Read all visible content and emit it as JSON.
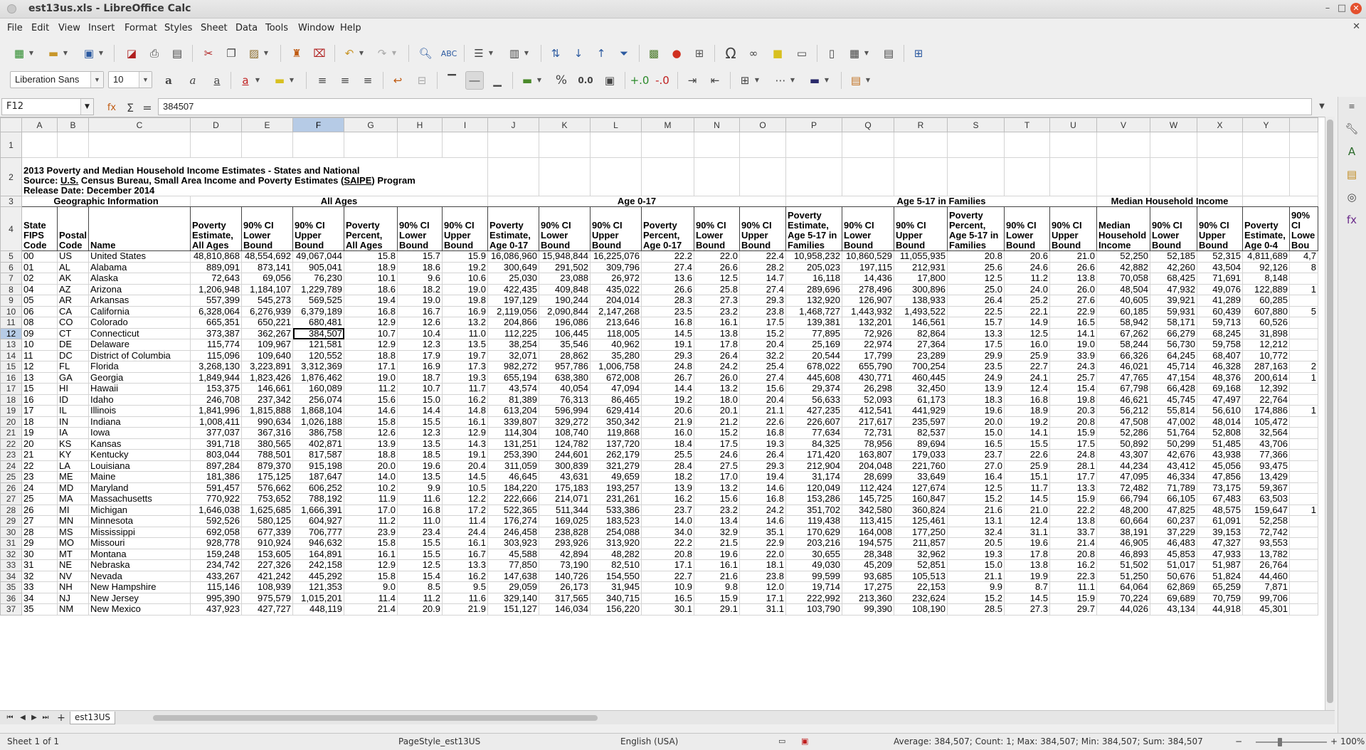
{
  "window": {
    "title": "est13us.xls - LibreOffice Calc"
  },
  "menu": [
    "File",
    "Edit",
    "View",
    "Insert",
    "Format",
    "Styles",
    "Sheet",
    "Data",
    "Tools",
    "Window",
    "Help"
  ],
  "font": {
    "name": "Liberation Sans",
    "size": "10"
  },
  "formula": {
    "cell_ref": "F12",
    "content": "384507"
  },
  "columns": [
    "A",
    "B",
    "C",
    "D",
    "E",
    "F",
    "G",
    "H",
    "I",
    "J",
    "K",
    "L",
    "M",
    "N",
    "O",
    "P",
    "Q",
    "R",
    "S",
    "T",
    "U",
    "V",
    "W",
    "X",
    "Y"
  ],
  "selected_column": "F",
  "selected_row": "12",
  "title_block": {
    "line1": "2013 Poverty and Median Household Income Estimates - States and National",
    "line2_prefix": "Source:  ",
    "line2_us": "U.S.",
    "line2_mid": " Census Bureau, Small Area Income and Poverty Estimates (",
    "line2_saipe": "SAIPE",
    "line2_suffix": ") Program",
    "line3": "Release Date:  December 2014"
  },
  "groups": {
    "geo": "Geographic Information",
    "all": "All Ages",
    "age017": "Age 0-17",
    "age517": "Age 5-17 in Families",
    "median": "Median Household Income"
  },
  "headers": [
    "State FIPS Code",
    "Postal Code",
    "Name",
    "Poverty Estimate, All Ages",
    "90% CI Lower Bound",
    "90% CI Upper Bound",
    "Poverty Percent, All Ages",
    "90% CI Lower Bound",
    "90% CI Upper Bound",
    "Poverty Estimate, Age 0-17",
    "90% CI Lower Bound",
    "90% CI Upper Bound",
    "Poverty Percent, Age 0-17",
    "90% CI Lower Bound",
    "90% CI Upper Bound",
    "Poverty Estimate, Age 5-17 in Families",
    "90% CI Lower Bound",
    "90% CI Upper Bound",
    "Poverty Percent, Age 5-17 in Families",
    "90% CI Lower Bound",
    "90% CI Upper Bound",
    "Median Household Income",
    "90% CI Lower Bound",
    "90% CI Upper Bound",
    "Poverty Estimate, Age 0-4",
    "90% CI Lowe Bou"
  ],
  "rows": [
    [
      "5",
      "00",
      "US",
      "United States",
      "48,810,868",
      "48,554,692",
      "49,067,044",
      "15.8",
      "15.7",
      "15.9",
      "16,086,960",
      "15,948,844",
      "16,225,076",
      "22.2",
      "22.0",
      "22.4",
      "10,958,232",
      "10,860,529",
      "11,055,935",
      "20.8",
      "20.6",
      "21.0",
      "52,250",
      "52,185",
      "52,315",
      "4,811,689",
      "4,7"
    ],
    [
      "6",
      "01",
      "AL",
      "Alabama",
      "889,091",
      "873,141",
      "905,041",
      "18.9",
      "18.6",
      "19.2",
      "300,649",
      "291,502",
      "309,796",
      "27.4",
      "26.6",
      "28.2",
      "205,023",
      "197,115",
      "212,931",
      "25.6",
      "24.6",
      "26.6",
      "42,882",
      "42,260",
      "43,504",
      "92,126",
      "8"
    ],
    [
      "7",
      "02",
      "AK",
      "Alaska",
      "72,643",
      "69,056",
      "76,230",
      "10.1",
      "9.6",
      "10.6",
      "25,030",
      "23,088",
      "26,972",
      "13.6",
      "12.5",
      "14.7",
      "16,118",
      "14,436",
      "17,800",
      "12.5",
      "11.2",
      "13.8",
      "70,058",
      "68,425",
      "71,691",
      "8,148",
      ""
    ],
    [
      "8",
      "04",
      "AZ",
      "Arizona",
      "1,206,948",
      "1,184,107",
      "1,229,789",
      "18.6",
      "18.2",
      "19.0",
      "422,435",
      "409,848",
      "435,022",
      "26.6",
      "25.8",
      "27.4",
      "289,696",
      "278,496",
      "300,896",
      "25.0",
      "24.0",
      "26.0",
      "48,504",
      "47,932",
      "49,076",
      "122,889",
      "1"
    ],
    [
      "9",
      "05",
      "AR",
      "Arkansas",
      "557,399",
      "545,273",
      "569,525",
      "19.4",
      "19.0",
      "19.8",
      "197,129",
      "190,244",
      "204,014",
      "28.3",
      "27.3",
      "29.3",
      "132,920",
      "126,907",
      "138,933",
      "26.4",
      "25.2",
      "27.6",
      "40,605",
      "39,921",
      "41,289",
      "60,285",
      ""
    ],
    [
      "10",
      "06",
      "CA",
      "California",
      "6,328,064",
      "6,276,939",
      "6,379,189",
      "16.8",
      "16.7",
      "16.9",
      "2,119,056",
      "2,090,844",
      "2,147,268",
      "23.5",
      "23.2",
      "23.8",
      "1,468,727",
      "1,443,932",
      "1,493,522",
      "22.5",
      "22.1",
      "22.9",
      "60,185",
      "59,931",
      "60,439",
      "607,880",
      "5"
    ],
    [
      "11",
      "08",
      "CO",
      "Colorado",
      "665,351",
      "650,221",
      "680,481",
      "12.9",
      "12.6",
      "13.2",
      "204,866",
      "196,086",
      "213,646",
      "16.8",
      "16.1",
      "17.5",
      "139,381",
      "132,201",
      "146,561",
      "15.7",
      "14.9",
      "16.5",
      "58,942",
      "58,171",
      "59,713",
      "60,526",
      ""
    ],
    [
      "12",
      "09",
      "CT",
      "Connecticut",
      "373,387",
      "362,267",
      "384,507",
      "10.7",
      "10.4",
      "11.0",
      "112,225",
      "106,445",
      "118,005",
      "14.5",
      "13.8",
      "15.2",
      "77,895",
      "72,926",
      "82,864",
      "13.3",
      "12.5",
      "14.1",
      "67,262",
      "66,279",
      "68,245",
      "31,898",
      ""
    ],
    [
      "13",
      "10",
      "DE",
      "Delaware",
      "115,774",
      "109,967",
      "121,581",
      "12.9",
      "12.3",
      "13.5",
      "38,254",
      "35,546",
      "40,962",
      "19.1",
      "17.8",
      "20.4",
      "25,169",
      "22,974",
      "27,364",
      "17.5",
      "16.0",
      "19.0",
      "58,244",
      "56,730",
      "59,758",
      "12,212",
      ""
    ],
    [
      "14",
      "11",
      "DC",
      "District of Columbia",
      "115,096",
      "109,640",
      "120,552",
      "18.8",
      "17.9",
      "19.7",
      "32,071",
      "28,862",
      "35,280",
      "29.3",
      "26.4",
      "32.2",
      "20,544",
      "17,799",
      "23,289",
      "29.9",
      "25.9",
      "33.9",
      "66,326",
      "64,245",
      "68,407",
      "10,772",
      ""
    ],
    [
      "15",
      "12",
      "FL",
      "Florida",
      "3,268,130",
      "3,223,891",
      "3,312,369",
      "17.1",
      "16.9",
      "17.3",
      "982,272",
      "957,786",
      "1,006,758",
      "24.8",
      "24.2",
      "25.4",
      "678,022",
      "655,790",
      "700,254",
      "23.5",
      "22.7",
      "24.3",
      "46,021",
      "45,714",
      "46,328",
      "287,163",
      "2"
    ],
    [
      "16",
      "13",
      "GA",
      "Georgia",
      "1,849,944",
      "1,823,426",
      "1,876,462",
      "19.0",
      "18.7",
      "19.3",
      "655,194",
      "638,380",
      "672,008",
      "26.7",
      "26.0",
      "27.4",
      "445,608",
      "430,771",
      "460,445",
      "24.9",
      "24.1",
      "25.7",
      "47,765",
      "47,154",
      "48,376",
      "200,614",
      "1"
    ],
    [
      "17",
      "15",
      "HI",
      "Hawaii",
      "153,375",
      "146,661",
      "160,089",
      "11.2",
      "10.7",
      "11.7",
      "43,574",
      "40,054",
      "47,094",
      "14.4",
      "13.2",
      "15.6",
      "29,374",
      "26,298",
      "32,450",
      "13.9",
      "12.4",
      "15.4",
      "67,798",
      "66,428",
      "69,168",
      "12,392",
      ""
    ],
    [
      "18",
      "16",
      "ID",
      "Idaho",
      "246,708",
      "237,342",
      "256,074",
      "15.6",
      "15.0",
      "16.2",
      "81,389",
      "76,313",
      "86,465",
      "19.2",
      "18.0",
      "20.4",
      "56,633",
      "52,093",
      "61,173",
      "18.3",
      "16.8",
      "19.8",
      "46,621",
      "45,745",
      "47,497",
      "22,764",
      ""
    ],
    [
      "19",
      "17",
      "IL",
      "Illinois",
      "1,841,996",
      "1,815,888",
      "1,868,104",
      "14.6",
      "14.4",
      "14.8",
      "613,204",
      "596,994",
      "629,414",
      "20.6",
      "20.1",
      "21.1",
      "427,235",
      "412,541",
      "441,929",
      "19.6",
      "18.9",
      "20.3",
      "56,212",
      "55,814",
      "56,610",
      "174,886",
      "1"
    ],
    [
      "20",
      "18",
      "IN",
      "Indiana",
      "1,008,411",
      "990,634",
      "1,026,188",
      "15.8",
      "15.5",
      "16.1",
      "339,807",
      "329,272",
      "350,342",
      "21.9",
      "21.2",
      "22.6",
      "226,607",
      "217,617",
      "235,597",
      "20.0",
      "19.2",
      "20.8",
      "47,508",
      "47,002",
      "48,014",
      "105,472",
      ""
    ],
    [
      "21",
      "19",
      "IA",
      "Iowa",
      "377,037",
      "367,316",
      "386,758",
      "12.6",
      "12.3",
      "12.9",
      "114,304",
      "108,740",
      "119,868",
      "16.0",
      "15.2",
      "16.8",
      "77,634",
      "72,731",
      "82,537",
      "15.0",
      "14.1",
      "15.9",
      "52,286",
      "51,764",
      "52,808",
      "32,564",
      ""
    ],
    [
      "22",
      "20",
      "KS",
      "Kansas",
      "391,718",
      "380,565",
      "402,871",
      "13.9",
      "13.5",
      "14.3",
      "131,251",
      "124,782",
      "137,720",
      "18.4",
      "17.5",
      "19.3",
      "84,325",
      "78,956",
      "89,694",
      "16.5",
      "15.5",
      "17.5",
      "50,892",
      "50,299",
      "51,485",
      "43,706",
      ""
    ],
    [
      "23",
      "21",
      "KY",
      "Kentucky",
      "803,044",
      "788,501",
      "817,587",
      "18.8",
      "18.5",
      "19.1",
      "253,390",
      "244,601",
      "262,179",
      "25.5",
      "24.6",
      "26.4",
      "171,420",
      "163,807",
      "179,033",
      "23.7",
      "22.6",
      "24.8",
      "43,307",
      "42,676",
      "43,938",
      "77,366",
      ""
    ],
    [
      "24",
      "22",
      "LA",
      "Louisiana",
      "897,284",
      "879,370",
      "915,198",
      "20.0",
      "19.6",
      "20.4",
      "311,059",
      "300,839",
      "321,279",
      "28.4",
      "27.5",
      "29.3",
      "212,904",
      "204,048",
      "221,760",
      "27.0",
      "25.9",
      "28.1",
      "44,234",
      "43,412",
      "45,056",
      "93,475",
      ""
    ],
    [
      "25",
      "23",
      "ME",
      "Maine",
      "181,386",
      "175,125",
      "187,647",
      "14.0",
      "13.5",
      "14.5",
      "46,645",
      "43,631",
      "49,659",
      "18.2",
      "17.0",
      "19.4",
      "31,174",
      "28,699",
      "33,649",
      "16.4",
      "15.1",
      "17.7",
      "47,095",
      "46,334",
      "47,856",
      "13,429",
      ""
    ],
    [
      "26",
      "24",
      "MD",
      "Maryland",
      "591,457",
      "576,662",
      "606,252",
      "10.2",
      "9.9",
      "10.5",
      "184,220",
      "175,183",
      "193,257",
      "13.9",
      "13.2",
      "14.6",
      "120,049",
      "112,424",
      "127,674",
      "12.5",
      "11.7",
      "13.3",
      "72,482",
      "71,789",
      "73,175",
      "59,367",
      ""
    ],
    [
      "27",
      "25",
      "MA",
      "Massachusetts",
      "770,922",
      "753,652",
      "788,192",
      "11.9",
      "11.6",
      "12.2",
      "222,666",
      "214,071",
      "231,261",
      "16.2",
      "15.6",
      "16.8",
      "153,286",
      "145,725",
      "160,847",
      "15.2",
      "14.5",
      "15.9",
      "66,794",
      "66,105",
      "67,483",
      "63,503",
      ""
    ],
    [
      "28",
      "26",
      "MI",
      "Michigan",
      "1,646,038",
      "1,625,685",
      "1,666,391",
      "17.0",
      "16.8",
      "17.2",
      "522,365",
      "511,344",
      "533,386",
      "23.7",
      "23.2",
      "24.2",
      "351,702",
      "342,580",
      "360,824",
      "21.6",
      "21.0",
      "22.2",
      "48,200",
      "47,825",
      "48,575",
      "159,647",
      "1"
    ],
    [
      "29",
      "27",
      "MN",
      "Minnesota",
      "592,526",
      "580,125",
      "604,927",
      "11.2",
      "11.0",
      "11.4",
      "176,274",
      "169,025",
      "183,523",
      "14.0",
      "13.4",
      "14.6",
      "119,438",
      "113,415",
      "125,461",
      "13.1",
      "12.4",
      "13.8",
      "60,664",
      "60,237",
      "61,091",
      "52,258",
      ""
    ],
    [
      "30",
      "28",
      "MS",
      "Mississippi",
      "692,058",
      "677,339",
      "706,777",
      "23.9",
      "23.4",
      "24.4",
      "246,458",
      "238,828",
      "254,088",
      "34.0",
      "32.9",
      "35.1",
      "170,629",
      "164,008",
      "177,250",
      "32.4",
      "31.1",
      "33.7",
      "38,191",
      "37,229",
      "39,153",
      "72,742",
      ""
    ],
    [
      "31",
      "29",
      "MO",
      "Missouri",
      "928,778",
      "910,924",
      "946,632",
      "15.8",
      "15.5",
      "16.1",
      "303,923",
      "293,926",
      "313,920",
      "22.2",
      "21.5",
      "22.9",
      "203,216",
      "194,575",
      "211,857",
      "20.5",
      "19.6",
      "21.4",
      "46,905",
      "46,483",
      "47,327",
      "93,553",
      ""
    ],
    [
      "32",
      "30",
      "MT",
      "Montana",
      "159,248",
      "153,605",
      "164,891",
      "16.1",
      "15.5",
      "16.7",
      "45,588",
      "42,894",
      "48,282",
      "20.8",
      "19.6",
      "22.0",
      "30,655",
      "28,348",
      "32,962",
      "19.3",
      "17.8",
      "20.8",
      "46,893",
      "45,853",
      "47,933",
      "13,782",
      ""
    ],
    [
      "33",
      "31",
      "NE",
      "Nebraska",
      "234,742",
      "227,326",
      "242,158",
      "12.9",
      "12.5",
      "13.3",
      "77,850",
      "73,190",
      "82,510",
      "17.1",
      "16.1",
      "18.1",
      "49,030",
      "45,209",
      "52,851",
      "15.0",
      "13.8",
      "16.2",
      "51,502",
      "51,017",
      "51,987",
      "26,764",
      ""
    ],
    [
      "34",
      "32",
      "NV",
      "Nevada",
      "433,267",
      "421,242",
      "445,292",
      "15.8",
      "15.4",
      "16.2",
      "147,638",
      "140,726",
      "154,550",
      "22.7",
      "21.6",
      "23.8",
      "99,599",
      "93,685",
      "105,513",
      "21.1",
      "19.9",
      "22.3",
      "51,250",
      "50,676",
      "51,824",
      "44,460",
      ""
    ],
    [
      "35",
      "33",
      "NH",
      "New Hampshire",
      "115,146",
      "108,939",
      "121,353",
      "9.0",
      "8.5",
      "9.5",
      "29,059",
      "26,173",
      "31,945",
      "10.9",
      "9.8",
      "12.0",
      "19,714",
      "17,275",
      "22,153",
      "9.9",
      "8.7",
      "11.1",
      "64,064",
      "62,869",
      "65,259",
      "7,871",
      ""
    ],
    [
      "36",
      "34",
      "NJ",
      "New Jersey",
      "995,390",
      "975,579",
      "1,015,201",
      "11.4",
      "11.2",
      "11.6",
      "329,140",
      "317,565",
      "340,715",
      "16.5",
      "15.9",
      "17.1",
      "222,992",
      "213,360",
      "232,624",
      "15.2",
      "14.5",
      "15.9",
      "70,224",
      "69,689",
      "70,759",
      "99,706",
      ""
    ],
    [
      "37",
      "35",
      "NM",
      "New Mexico",
      "437,923",
      "427,727",
      "448,119",
      "21.4",
      "20.9",
      "21.9",
      "151,127",
      "146,034",
      "156,220",
      "30.1",
      "29.1",
      "31.1",
      "103,790",
      "99,390",
      "108,190",
      "28.5",
      "27.3",
      "29.7",
      "44,026",
      "43,134",
      "44,918",
      "45,301",
      ""
    ]
  ],
  "sheet_tab": "est13US",
  "status": {
    "sheet": "Sheet 1 of 1",
    "pagestyle": "PageStyle_est13US",
    "language": "English (USA)",
    "summary": "Average: 384,507; Count: 1; Max: 384,507; Min: 384,507; Sum: 384,507",
    "zoom": "100%"
  }
}
